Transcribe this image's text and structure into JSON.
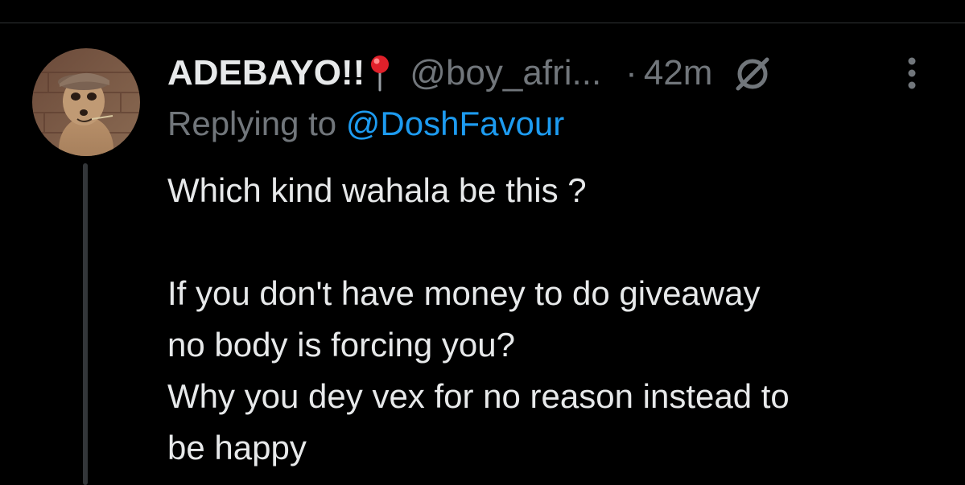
{
  "colors": {
    "background": "#000000",
    "text_primary": "#e7e9ea",
    "text_secondary": "#71767b",
    "link": "#1d9bf0",
    "thread_line": "#333639"
  },
  "tweet": {
    "display_name": "ADEBAYO!!",
    "name_emoji": "round-pushpin-icon",
    "handle": "@boy_afri...",
    "separator": "·",
    "timestamp": "42m",
    "replying_prefix": "Replying to",
    "replying_to": "@DoshFavour",
    "body_lines": [
      "Which kind wahala be this ?",
      "",
      "If you don't have money to do giveaway",
      "no body is forcing you?",
      "Why you dey vex for no reason instead to",
      "be happy"
    ]
  }
}
